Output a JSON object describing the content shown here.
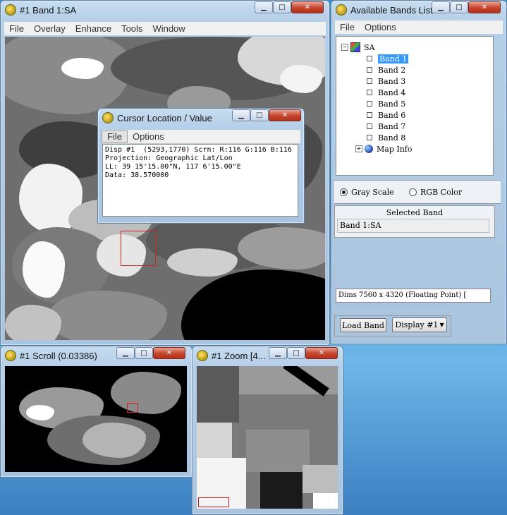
{
  "band_window": {
    "title": "#1 Band 1:SA",
    "menu": [
      "File",
      "Overlay",
      "Enhance",
      "Tools",
      "Window"
    ]
  },
  "bands_window": {
    "title": "Available Bands List",
    "menu": [
      "File",
      "Options"
    ],
    "tree_root": "SA",
    "bands": [
      "Band 1",
      "Band 2",
      "Band 3",
      "Band 4",
      "Band 5",
      "Band 6",
      "Band 7",
      "Band 8"
    ],
    "selected_band_index": 0,
    "map_info": "Map Info",
    "radio_gray": "Gray Scale",
    "radio_rgb": "RGB Color",
    "radio_selected": "Gray Scale",
    "selected_band_header": "Selected Band",
    "selected_band_value": "Band 1:SA",
    "dims": "Dims 7560 x 4320 (Floating Point) [",
    "load_band": "Load Band",
    "display": "Display #1"
  },
  "cursor_window": {
    "title": "Cursor Location / Value",
    "menu": [
      "File",
      "Options"
    ],
    "lines": [
      "Disp #1  (5293,1770) Scrn: R:116 G:116 B:116",
      "Projection: Geographic Lat/Lon",
      "LL: 39 15'15.00\"N, 117 6'15.00\"E",
      "Data: 38.570000"
    ]
  },
  "scroll_window": {
    "title": "#1 Scroll (0.03386)"
  },
  "zoom_window": {
    "title": "#1 Zoom [4..."
  },
  "controls": {
    "min": "▁",
    "max": "□",
    "close": "✕"
  },
  "colors": {
    "selection": "#3399ff",
    "roi_box": "#d02020"
  }
}
